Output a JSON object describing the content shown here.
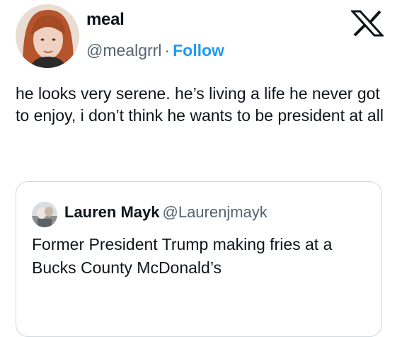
{
  "tweet": {
    "display_name": "meal",
    "handle": "@mealgrrl",
    "separator": "·",
    "follow_label": "Follow",
    "text": "he looks very serene. he’s living a life he never got to enjoy, i don’t think he wants to be president at all",
    "logo_icon": "x-logo-icon",
    "avatar_icon": "avatar-photo"
  },
  "quoted": {
    "display_name": "Lauren Mayk",
    "handle": "@Laurenjmayk",
    "text": "Former President Trump making fries at a Bucks County McDonald’s",
    "avatar_icon": "avatar-photo"
  },
  "colors": {
    "link": "#1d9bf0",
    "secondary_text": "#536471",
    "border": "#cfd9de",
    "text": "#0f1419"
  }
}
